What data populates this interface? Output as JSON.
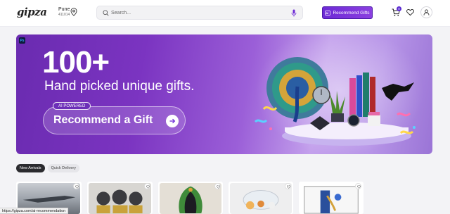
{
  "header": {
    "logo_text": "gipza",
    "location": {
      "city": "Pune",
      "pincode": "411014"
    },
    "search": {
      "placeholder": "Search..."
    },
    "recommend_button": "Recommend Gifts",
    "cart_count": "0",
    "icons": [
      "location-pin-icon",
      "search-icon",
      "mic-icon",
      "ai-gift-icon",
      "cart-icon",
      "heart-icon",
      "user-icon"
    ]
  },
  "banner": {
    "ps_badge": "Ps",
    "headline": "100+",
    "subheadline": "Hand picked unique gifts.",
    "pill": "AI POWERED",
    "cta": "Recommend a Gift"
  },
  "filters": [
    {
      "label": "New Arrivals",
      "active": true
    },
    {
      "label": "Quick Delivery",
      "active": false
    }
  ],
  "status_url": "https://gipza.com/ai-recommendation",
  "colors": {
    "brand_purple": "#6d2ad6",
    "banner_dark": "#6a2bb0"
  }
}
